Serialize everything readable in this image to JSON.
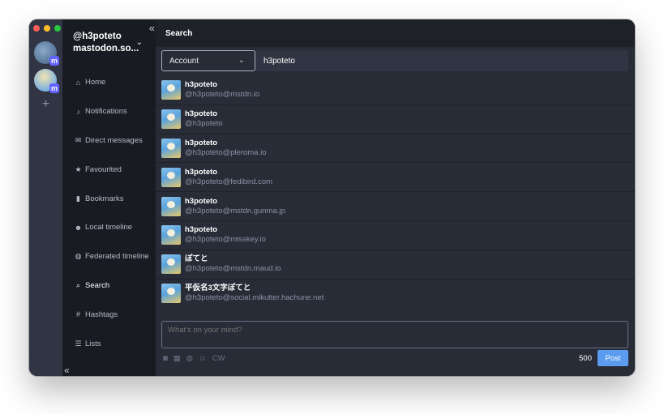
{
  "account_column": {
    "add_label": "+"
  },
  "nav": {
    "collapse_glyph": "«",
    "account_name": "@h3poteto",
    "account_server": "mastodon.so...",
    "items": [
      {
        "label": "Home",
        "icon": "home-icon"
      },
      {
        "label": "Notifications",
        "icon": "bell-icon"
      },
      {
        "label": "Direct messages",
        "icon": "envelope-icon"
      },
      {
        "label": "Favourited",
        "icon": "star-icon"
      },
      {
        "label": "Bookmarks",
        "icon": "bookmark-icon"
      },
      {
        "label": "Local timeline",
        "icon": "users-icon"
      },
      {
        "label": "Federated timeline",
        "icon": "globe-icon"
      },
      {
        "label": "Search",
        "icon": "search-icon",
        "active": true
      },
      {
        "label": "Hashtags",
        "icon": "hash-icon"
      },
      {
        "label": "Lists",
        "icon": "list-icon"
      }
    ]
  },
  "main": {
    "title": "Search",
    "search": {
      "type_selected": "Account",
      "query": "h3poteto"
    },
    "results": [
      {
        "name": "h3poteto",
        "acct": "@h3poteto@mstdn.io"
      },
      {
        "name": "h3poteto",
        "acct": "@h3poteto"
      },
      {
        "name": "h3poteto",
        "acct": "@h3poteto@pleroma.io"
      },
      {
        "name": "h3poteto",
        "acct": "@h3poteto@fedibird.com"
      },
      {
        "name": "h3poteto",
        "acct": "@h3poteto@mstdn.gunma.jp"
      },
      {
        "name": "h3poteto",
        "acct": "@h3poteto@misskey.io"
      },
      {
        "name": "ぽてと",
        "acct": "@h3poteto@mstdn.maud.io"
      },
      {
        "name": "平仮名3文字ぽてと",
        "acct": "@h3poteto@social.mikutter.hachune.net"
      }
    ]
  },
  "compose": {
    "placeholder": "What's on your mind?",
    "cw_label": "CW",
    "char_count": "500",
    "post_label": "Post"
  },
  "colors": {
    "accent": "#5b9bf0",
    "nav_bg": "#191b22",
    "main_bg": "#282c37"
  }
}
